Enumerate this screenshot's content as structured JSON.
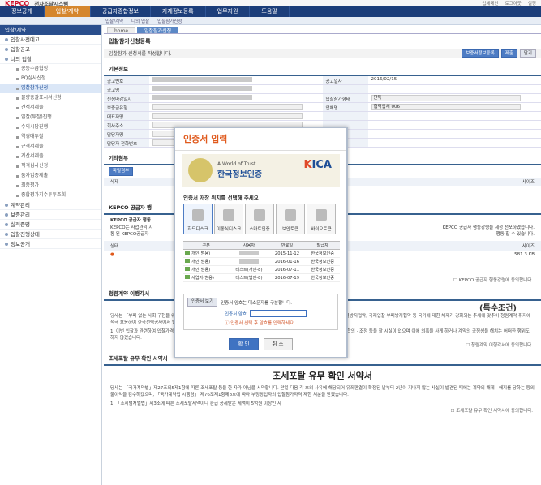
{
  "topbar": {
    "logo": "KEPCO",
    "brand": "전자조달시스템",
    "links": [
      "업체메인",
      "로그아웃",
      "설정"
    ]
  },
  "nav": {
    "items": [
      "정보공개",
      "입찰/계약",
      "공급자종합정보",
      "자재정보등록",
      "업무지원",
      "도움말"
    ],
    "active": 1
  },
  "subnav": {
    "crumbs": [
      "입찰/계약",
      "나의 입찰",
      "입찰참가신청"
    ]
  },
  "sidebar": {
    "header": "입찰/계약",
    "items": [
      "입찰사전예고",
      "입찰공고",
      "나의 입찰"
    ],
    "subitems": [
      "공동수급협정",
      "PQ심사신청",
      "입찰참가신청",
      "물량총괄표시서신청",
      "견적서제출",
      "입찰(투찰)진행",
      "수의시담진행",
      "역경매투찰",
      "규격서제출",
      "계산서제출",
      "적격심사신청",
      "품가입증제출",
      "최종평가",
      "종합평가지수투투조회"
    ],
    "selected": 2,
    "items2": [
      "계약관리",
      "보증관리",
      "실적증명",
      "입찰진행상태",
      "정보공개"
    ]
  },
  "tabs": {
    "home": "home",
    "current": "입찰참가신청"
  },
  "main": {
    "title": "입찰참가신청등록",
    "guide": "입찰참가 신청서를 작성합니다.",
    "buttons": {
      "cert": "보증서정보등록",
      "submit": "제출",
      "close": "닫기"
    }
  },
  "basic": {
    "title": "기본정보",
    "rows": [
      {
        "l1": "공고번호",
        "v1": "",
        "l2": "공고일자",
        "v2": "2016/02/15"
      },
      {
        "l1": "공고명",
        "v1": "",
        "l2": "",
        "v2": ""
      },
      {
        "l1": "신청마감일시",
        "v1": "",
        "l2": "입찰참가형태",
        "v2": "단독"
      },
      {
        "l1": "보증금유형",
        "v1": "",
        "l2": "업체명",
        "v2": "협력업체 006"
      },
      {
        "l1": "대표자명",
        "v1": "",
        "l2": "",
        "v2": ""
      },
      {
        "l1": "회사주소",
        "v1": "",
        "l2": "",
        "v2": ""
      },
      {
        "l1": "담당자명",
        "v1": "",
        "l2": "",
        "v2": ""
      },
      {
        "l1": "담당자 전화번호",
        "v1": "",
        "l2": "",
        "v2": ""
      }
    ]
  },
  "other": {
    "title": "기타첨부",
    "btn": "파일첨부",
    "cols": [
      "삭제",
      "상태",
      "사이즈"
    ]
  },
  "kepco": {
    "title": "KEPCO 공급자 행",
    "box": "KEPCO 공급자 행동",
    "text1": "KEPCO는 사업관리 지",
    "text2": "KEPCO 공급자 행동강령을 제정 선포하였습니다.",
    "text3": "통 된 KEPCO공급자",
    "text4": "행동 할 수 있습니다.",
    "col1": "상태",
    "col2": "사이즈",
    "size": "581.3 KB",
    "agree": "KEPCO 공급자 행동강령에 동의합니다."
  },
  "clean": {
    "title": "청렴계약 이행각서",
    "sub": "(특수조건)",
    "para1": "당사는 「부패 없는 사회 구현을 위하여 …」 국가의 발전에 필요한 중요한 관건이 됨을 깊이 인식하여, 국제적으로도 OECD뇌물방지협약, 국제입찰 부패방지협약 등 국가에 대한 체제가 강화되는 추세에 맞추어 청렴계약 취지에 적극 호응하여 한국전력공사에서 발주하는 모든 공사, 물품, 용역 등에 입찰에 참여할 경우 당사 임직원과 대리인은",
    "para2": "1. 이번 입찰과 관련하여 입찰가격 또는 특정인의 낙찰을 위한 담합 등 어떠한 사항에 대하여도 경쟁가들과 사전에 협의 · 연락 · 합의 · 조정 등을 할 시실이 없으며 이에 의혹을 사게 하거나 계약의 공정성을 해치는 어떠한 행위도 하지 않겠습니다.",
    "agree": "청렴계약 이행각서에 동의합니다."
  },
  "tax": {
    "title": "조세포탈 유무 확인 서약서",
    "big": "조세포탈 유무 확인 서약서",
    "para1": "당사는 「국가계약법」제27조의5제1항에 따른 조세포탈 등을 한 자가 아님을 서약합니다. 만일 다음 각 호의 사유에 해당되어 유죄판결이 확정된 날부터 2년이 지나지 않는 사실이 발견된 때에는 계약의 해제 · 해지를 당하는 등의 불이익을 감수하겠으며, 「국가계약법 시행령」 제76조제1항제8호에 따라 부정당업자의 입찰참가자격 제한 처분을 받겠습니다.",
    "para2": "1. 「조세범처벌법」제3조에 따른 조세포탈세액이나 환급 공제받은 세액이 5억원 이상인 자",
    "agree": "조세포탈 유무 확인 서약서에 동의합니다."
  },
  "modal": {
    "title": "인증서 입력",
    "banner_small": "A World of Trust",
    "banner_big": "한국정보인증",
    "banner_logo_a": "K",
    "banner_logo_b": "ICA",
    "loc_title": "인증서 저장 위치를 선택해 주세요",
    "locations": [
      "하드디스크",
      "이동식디스크",
      "스마트인증",
      "보안토큰",
      "바이오토큰"
    ],
    "cols": [
      "구분",
      "사용자",
      "만료일",
      "발급자"
    ],
    "certs": [
      {
        "type": "개인(범용)",
        "user": "",
        "exp": "2015-11-12",
        "issuer": "한국정보인증"
      },
      {
        "type": "개인(범용)",
        "user": "",
        "exp": "2016-01-16",
        "issuer": "한국정보인증"
      },
      {
        "type": "개인(범용)",
        "user": "테스트(개인-8)",
        "exp": "2016-07-11",
        "issuer": "한국정보인증"
      },
      {
        "type": "사업자(범용)",
        "user": "테스트(법인-8)",
        "exp": "2016-07-19",
        "issuer": "한국정보인증"
      }
    ],
    "view_btn": "인증서 보기",
    "case_note": "인증서 암호는 대소문자를 구분합니다.",
    "pw_label": "인증서 암호",
    "pw_hint": "인증서 선택 후 암호를 입력하세요.",
    "ok": "확 인",
    "cancel": "취 소"
  }
}
